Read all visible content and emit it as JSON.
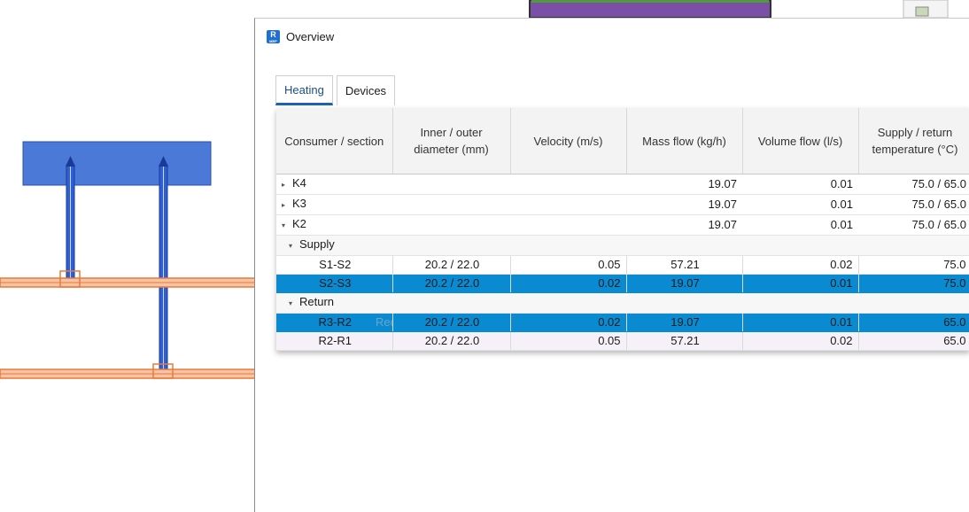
{
  "window": {
    "title": "Overview",
    "app_icon_letter": "R",
    "app_icon_sub": "MEP"
  },
  "tabs": [
    {
      "label": "Heating"
    },
    {
      "label": "Devices"
    }
  ],
  "table": {
    "headers": {
      "consumer": "Consumer / section",
      "diameter": "Inner / outer diameter (mm)",
      "velocity": "Velocity (m/s)",
      "mass": "Mass flow (kg/h)",
      "volume": "Volume flow (l/s)",
      "temp": "Supply / return temperature (°C)"
    },
    "groups": {
      "k4": {
        "name": "K4",
        "mass": "19.07",
        "volume": "0.01",
        "temp": "75.0 / 65.0"
      },
      "k3": {
        "name": "K3",
        "mass": "19.07",
        "volume": "0.01",
        "temp": "75.0 / 65.0"
      },
      "k2": {
        "name": "K2",
        "mass": "19.07",
        "volume": "0.01",
        "temp": "75.0 / 65.0"
      }
    },
    "supply": {
      "label": "Supply",
      "rows": [
        {
          "section": "S1-S2",
          "diameter": "20.2 / 22.0",
          "velocity": "0.05",
          "mass": "57.21",
          "volume": "0.02",
          "temp": "75.0"
        },
        {
          "section": "S2-S3",
          "diameter": "20.2 / 22.0",
          "velocity": "0.02",
          "mass": "19.07",
          "volume": "0.01",
          "temp": "75.0"
        }
      ]
    },
    "return": {
      "label": "Return",
      "rows": [
        {
          "section": "R3-R2",
          "diameter": "20.2 / 22.0",
          "velocity": "0.02",
          "mass": "19.07",
          "volume": "0.01",
          "temp": "65.0"
        },
        {
          "section": "R2-R1",
          "diameter": "20.2 / 22.0",
          "velocity": "0.05",
          "mass": "57.21",
          "volume": "0.02",
          "temp": "65.0"
        }
      ]
    },
    "ghost_text": "Rectangular"
  },
  "colors": {
    "selection": "#0a8ad0",
    "pipe": "#e87a3c",
    "riser": "#2f5fd0",
    "radiator": "#4a79d8"
  }
}
